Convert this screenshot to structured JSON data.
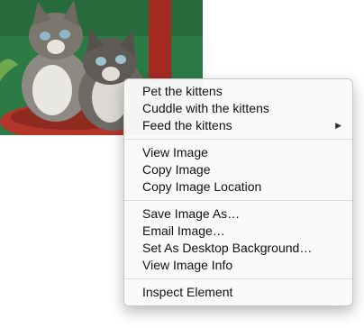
{
  "photo": {
    "alt_icon": "kittens-photo"
  },
  "menu": {
    "groups": [
      [
        {
          "label": "Pet the kittens"
        },
        {
          "label": "Cuddle with the kittens"
        },
        {
          "label": "Feed the kittens",
          "has_submenu": true
        }
      ],
      [
        {
          "label": "View Image"
        },
        {
          "label": "Copy Image"
        },
        {
          "label": "Copy Image Location"
        }
      ],
      [
        {
          "label": "Save Image As…"
        },
        {
          "label": "Email Image…"
        },
        {
          "label": "Set As Desktop Background…"
        },
        {
          "label": "View Image Info"
        }
      ],
      [
        {
          "label": "Inspect Element"
        }
      ]
    ]
  },
  "colors": {
    "photo_background": "#2f7a45",
    "basket": "#b3352a",
    "menu_background": "#fafafa"
  }
}
